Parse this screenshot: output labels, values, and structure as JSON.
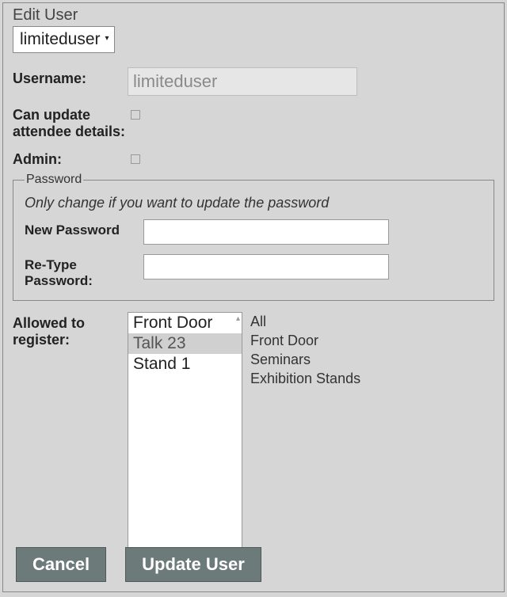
{
  "panel_title": "Edit User",
  "user_select": {
    "value": "limiteduser"
  },
  "labels": {
    "username": "Username:",
    "can_update": "Can update attendee details:",
    "admin": "Admin:",
    "allowed": "Allowed to register:"
  },
  "username_value": "limiteduser",
  "can_update_checked": false,
  "admin_checked": false,
  "password_fieldset": {
    "legend": "Password",
    "hint": "Only change if you want to update the password",
    "new_label": "New Password",
    "retype_label": "Re-Type Password:",
    "new_value": "",
    "retype_value": ""
  },
  "listbox": {
    "options": [
      {
        "label": "Front Door",
        "selected": false
      },
      {
        "label": "Talk 23",
        "selected": true
      },
      {
        "label": "Stand 1",
        "selected": false
      }
    ]
  },
  "available": [
    "All",
    "Front Door",
    "Seminars",
    "Exhibition Stands"
  ],
  "buttons": {
    "cancel": "Cancel",
    "update": "Update User"
  },
  "colors": {
    "panel_bg": "#d6d6d6",
    "button_bg": "#6c7a79",
    "button_fg": "#ffffff"
  }
}
